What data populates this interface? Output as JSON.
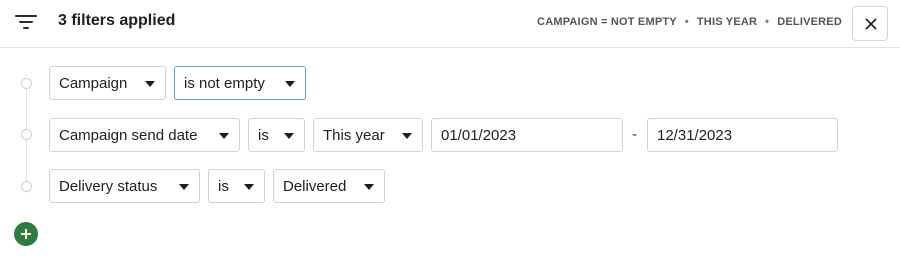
{
  "header": {
    "title": "3 filters applied",
    "summary": [
      "CAMPAIGN = NOT EMPTY",
      "THIS YEAR",
      "DELIVERED"
    ],
    "separator": "•"
  },
  "filters": [
    {
      "field": "Campaign",
      "operator": "is not empty"
    },
    {
      "field": "Campaign send date",
      "operator": "is",
      "value": "This year",
      "start_date": "01/01/2023",
      "range_separator": "-",
      "end_date": "12/31/2023"
    },
    {
      "field": "Delivery status",
      "operator": "is",
      "value": "Delivered"
    }
  ],
  "icons": {
    "filter": "filter-lines-icon",
    "close": "close-x-icon",
    "add": "plus-icon",
    "dropdown": "caret-down-icon"
  },
  "colors": {
    "add_button": "#2f7d3c",
    "focus_border": "#6f9bc7"
  }
}
